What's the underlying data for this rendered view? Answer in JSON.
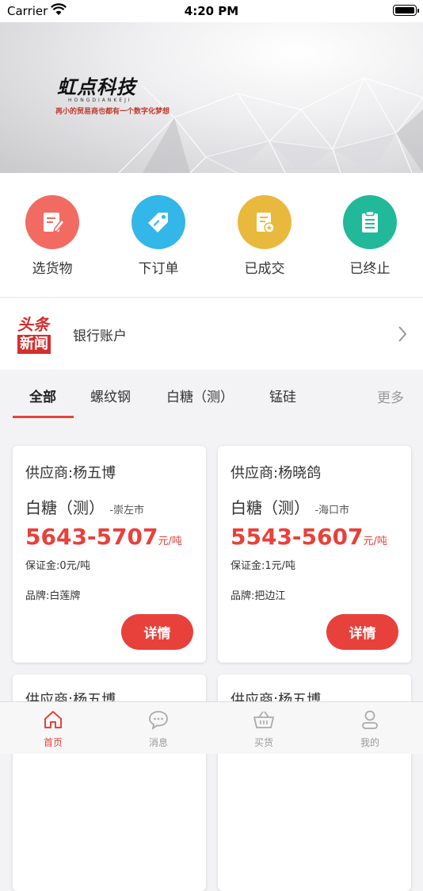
{
  "status_bar": {
    "carrier": "Carrier",
    "time": "4:20 PM"
  },
  "banner": {
    "brand": "虹点科技",
    "brand_pinyin": "HONGDIANKEJI",
    "slogan": "再小的贸易商也都有一个数字化梦想"
  },
  "quick_actions": [
    {
      "label": "选货物",
      "icon": "edit-icon",
      "color": "#f26b63"
    },
    {
      "label": "下订单",
      "icon": "tag-icon",
      "color": "#33b6e8"
    },
    {
      "label": "已成交",
      "icon": "certificate-icon",
      "color": "#e8b93c"
    },
    {
      "label": "已终止",
      "icon": "clipboard-icon",
      "color": "#22b89a"
    }
  ],
  "news": {
    "logo_line1": "头条",
    "logo_line2": "新闻",
    "text": "银行账户"
  },
  "tabs": {
    "items": [
      "全部",
      "螺纹钢",
      "白糖（测）",
      "锰硅"
    ],
    "more": "更多"
  },
  "cards": [
    {
      "supplier": "供应商:杨五博",
      "product": "白糖（测）",
      "location": "-崇左市",
      "price": "5643-5707",
      "unit": "元/吨",
      "deposit": "保证金:0元/吨",
      "brand": "品牌:白莲牌",
      "button": "详情"
    },
    {
      "supplier": "供应商:杨晓鸽",
      "product": "白糖（测）",
      "location": "-海口市",
      "price": "5543-5607",
      "unit": "元/吨",
      "deposit": "保证金:1元/吨",
      "brand": "品牌:把边江",
      "button": "详情"
    },
    {
      "supplier": "供应商:杨五博"
    },
    {
      "supplier": "供应商:杨五博"
    }
  ],
  "tabbar": [
    {
      "label": "首页",
      "icon": "home-icon",
      "active": true
    },
    {
      "label": "消息",
      "icon": "message-icon",
      "active": false
    },
    {
      "label": "买货",
      "icon": "basket-icon",
      "active": false
    },
    {
      "label": "我的",
      "icon": "user-icon",
      "active": false
    }
  ],
  "colors": {
    "accent": "#e8413b",
    "background": "#f3f3f5"
  }
}
